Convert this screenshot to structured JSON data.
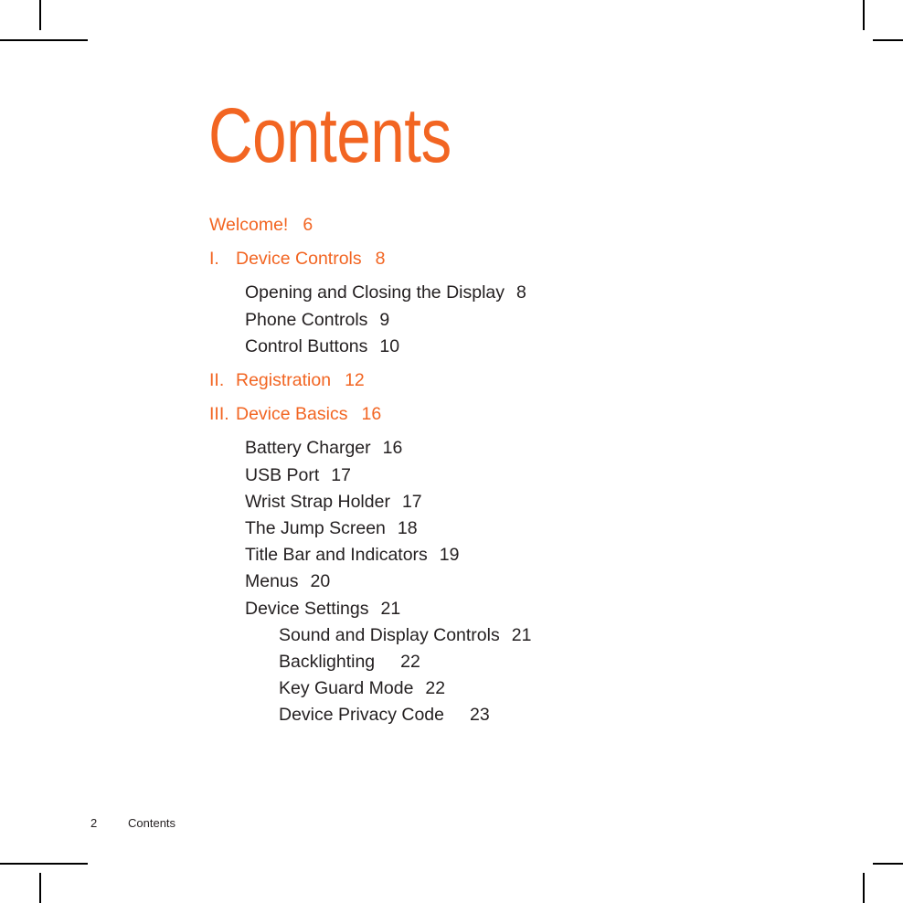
{
  "document": {
    "title": "Contents",
    "accent_color": "#F26522",
    "text_color": "#231F20",
    "background_color": "#FFFFFF"
  },
  "toc": {
    "entries": [
      {
        "level": 0,
        "numeral": "",
        "label": "Welcome!",
        "page": "6",
        "wide_gap": false
      },
      {
        "level": 1,
        "numeral": "I.",
        "label": "Device Controls",
        "page": "8",
        "wide_gap": false
      },
      {
        "level": 2,
        "numeral": "",
        "label": "Opening and Closing the Display",
        "page": "8",
        "wide_gap": false
      },
      {
        "level": 2,
        "numeral": "",
        "label": "Phone Controls",
        "page": "9",
        "wide_gap": false
      },
      {
        "level": 2,
        "numeral": "",
        "label": "Control Buttons",
        "page": "10",
        "wide_gap": false
      },
      {
        "level": 1,
        "numeral": "II.",
        "label": "Registration",
        "page": "12",
        "wide_gap": false
      },
      {
        "level": 1,
        "numeral": "III.",
        "label": "Device Basics",
        "page": "16",
        "wide_gap": false
      },
      {
        "level": 2,
        "numeral": "",
        "label": "Battery Charger",
        "page": "16",
        "wide_gap": false
      },
      {
        "level": 2,
        "numeral": "",
        "label": "USB Port",
        "page": "17",
        "wide_gap": false
      },
      {
        "level": 2,
        "numeral": "",
        "label": "Wrist Strap Holder",
        "page": "17",
        "wide_gap": false
      },
      {
        "level": 2,
        "numeral": "",
        "label": "The Jump Screen",
        "page": "18",
        "wide_gap": false
      },
      {
        "level": 2,
        "numeral": "",
        "label": "Title Bar and Indicators",
        "page": "19",
        "wide_gap": false
      },
      {
        "level": 2,
        "numeral": "",
        "label": "Menus",
        "page": "20",
        "wide_gap": false
      },
      {
        "level": 2,
        "numeral": "",
        "label": "Device Settings",
        "page": "21",
        "wide_gap": false
      },
      {
        "level": 3,
        "numeral": "",
        "label": "Sound and Display Controls",
        "page": "21",
        "wide_gap": false
      },
      {
        "level": 3,
        "numeral": "",
        "label": "Backlighting",
        "page": "22",
        "wide_gap": true
      },
      {
        "level": 3,
        "numeral": "",
        "label": "Key Guard Mode",
        "page": "22",
        "wide_gap": false
      },
      {
        "level": 3,
        "numeral": "",
        "label": "Device Privacy Code",
        "page": "23",
        "wide_gap": true
      }
    ]
  },
  "footer": {
    "page_number": "2",
    "section_label": "Contents"
  }
}
